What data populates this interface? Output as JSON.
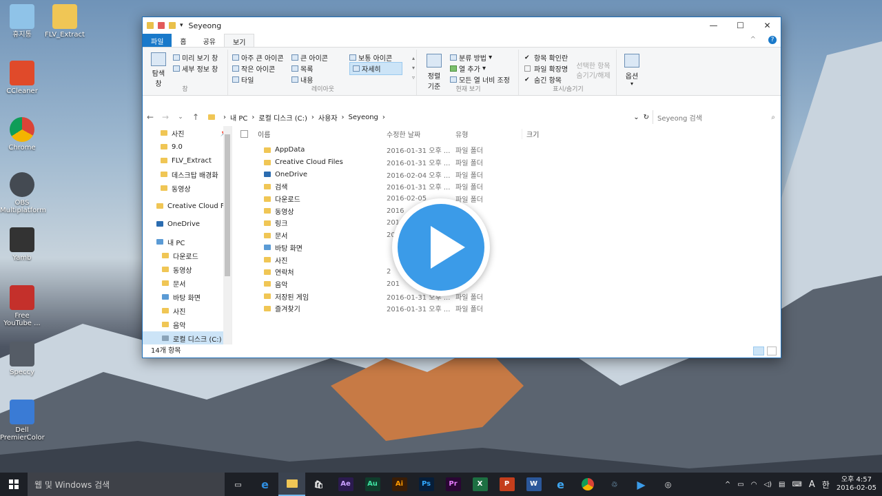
{
  "desktop": [
    {
      "label": "휴지통",
      "color": "#8fc3e8"
    },
    {
      "label": "FLV_Extract",
      "color": "#f0c655"
    },
    {
      "label": "CCleaner",
      "color": "#e04a2a"
    },
    {
      "label": "Chrome",
      "color": "#3d9a46"
    },
    {
      "label": "OBS Multiplatform",
      "color": "#444a52"
    },
    {
      "label": "Yamb",
      "color": "#333333"
    },
    {
      "label": "Free YouTube ...",
      "color": "#c4302b"
    },
    {
      "label": "Speccy",
      "color": "#555c66"
    },
    {
      "label": "Dell PremierColor",
      "color": "#3a7bd5"
    }
  ],
  "window": {
    "title": "Seyeong",
    "controls": [
      "—",
      "☐",
      "✕"
    ],
    "tabs": [
      "파일",
      "홈",
      "공유",
      "보기"
    ],
    "ribbon": {
      "pane": {
        "big": "탐색 창",
        "items": [
          "미리 보기 창",
          "세부 정보 창"
        ],
        "label": "창"
      },
      "layout": {
        "items": [
          "아주 큰 아이콘",
          "큰 아이콘",
          "보통 아이콘",
          "작은 아이콘",
          "목록",
          "자세히",
          "타일",
          "내용"
        ],
        "label": "레이아웃"
      },
      "view": {
        "big": "정렬 기준",
        "items": [
          "분류 방법",
          "열 추가",
          "모든 열 너비 조정"
        ],
        "label": "현재 보기"
      },
      "show": {
        "items": [
          "항목 확인란",
          "파일 확장명",
          "숨긴 항목"
        ],
        "checked": [
          true,
          false,
          true
        ],
        "hide": "선택한 항목 숨기기/해제",
        "label": "표시/숨기기"
      },
      "options": "옵션"
    },
    "breadcrumb": [
      "내 PC",
      "로컬 디스크 (C:)",
      "사용자",
      "Seyeong"
    ],
    "search_placeholder": "Seyeong 검색",
    "nav": [
      "사진",
      "9.0",
      "FLV_Extract",
      "데스크탑 배경화",
      "동영상",
      "Creative Cloud Fil",
      "OneDrive",
      "내 PC",
      "다운로드",
      "동영상",
      "문서",
      "바탕 화면",
      "사진",
      "음악",
      "로컬 디스크 (C:)"
    ],
    "columns": [
      "이름",
      "수정한 날짜",
      "유형",
      "크기"
    ],
    "files": [
      {
        "name": "AppData",
        "date": "2016-01-31 오후 ...",
        "type": "파일 폴더"
      },
      {
        "name": "Creative Cloud Files",
        "date": "2016-01-31 오후 ...",
        "type": "파일 폴더"
      },
      {
        "name": "OneDrive",
        "date": "2016-02-04 오후 ...",
        "type": "파일 폴더"
      },
      {
        "name": "검색",
        "date": "2016-01-31 오후 ...",
        "type": "파일 폴더"
      },
      {
        "name": "다운로드",
        "date": "2016-02-05",
        "type": "파일 폴더"
      },
      {
        "name": "동영상",
        "date": "2016",
        "type": ""
      },
      {
        "name": "링크",
        "date": "201",
        "type": ""
      },
      {
        "name": "문서",
        "date": "201",
        "type": ""
      },
      {
        "name": "바탕 화면",
        "date": "",
        "type": ""
      },
      {
        "name": "사진",
        "date": "",
        "type": ""
      },
      {
        "name": "연락처",
        "date": "2",
        "type": "폴더"
      },
      {
        "name": "음악",
        "date": "201",
        "type": "폴더"
      },
      {
        "name": "저장된 게임",
        "date": "2016-01-31 오후 ...",
        "type": "파일 폴더"
      },
      {
        "name": "즐겨찾기",
        "date": "2016-01-31 오후 ...",
        "type": "파일 폴더"
      }
    ],
    "status": "14개 항목"
  },
  "taskbar": {
    "search": "웹 및 Windows 검색",
    "apps": [
      {
        "label": "Ae",
        "color": "#2b1a4f",
        "fg": "#c9a0ff"
      },
      {
        "label": "Au",
        "color": "#103d2c",
        "fg": "#3fe3a3"
      },
      {
        "label": "Ai",
        "color": "#3a1d06",
        "fg": "#ff9a00"
      },
      {
        "label": "Ps",
        "color": "#061e3a",
        "fg": "#31a8ff"
      },
      {
        "label": "Pr",
        "color": "#2a0634",
        "fg": "#e77cff"
      },
      {
        "label": "X",
        "color": "#1d6f42",
        "fg": "#ffffff"
      },
      {
        "label": "P",
        "color": "#c43e1c",
        "fg": "#ffffff"
      },
      {
        "label": "W",
        "color": "#2b579a",
        "fg": "#ffffff"
      }
    ],
    "ime": "A",
    "ime2": "한",
    "time": "오후 4:57",
    "date": "2016-02-05"
  }
}
